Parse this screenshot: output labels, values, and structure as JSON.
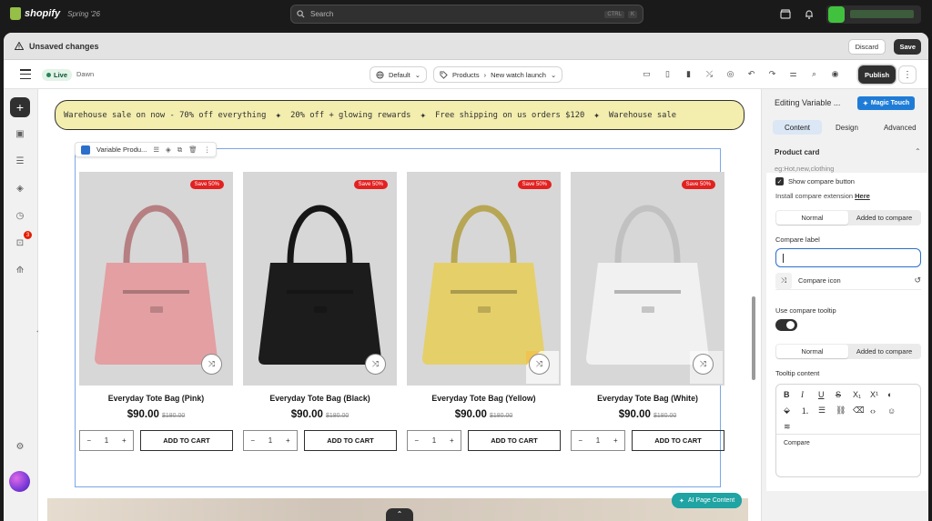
{
  "topbar": {
    "brand": "shopify",
    "season": "Spring '26",
    "search_placeholder": "Search",
    "shortcut_keys": [
      "CTRL",
      "K"
    ]
  },
  "unsaved": {
    "message": "Unsaved changes",
    "discard_label": "Discard",
    "save_label": "Save"
  },
  "toolbar": {
    "live_label": "Live",
    "theme_name": "Dawn",
    "template_select": "Default",
    "page_breadcrumb_1": "Products",
    "page_breadcrumb_2": "New watch launch",
    "publish_label": "Publish"
  },
  "rail": {
    "badge_count": "3"
  },
  "marquee": {
    "items": [
      "Warehouse sale on now - 70% off everything",
      "20% off + glowing rewards",
      "Free shipping on us orders $120",
      "Warehouse sale"
    ]
  },
  "section": {
    "tag_label": "Variable Produ..."
  },
  "products": [
    {
      "title": "Everyday Tote Bag (Pink)",
      "price": "$90.00",
      "compare_price": "$180.00",
      "badge": "Save 50%",
      "color": "#e39fa2",
      "qty": "1",
      "cta": "ADD TO CART"
    },
    {
      "title": "Everyday Tote Bag (Black)",
      "price": "$90.00",
      "compare_price": "$180.00",
      "badge": "Save 50%",
      "color": "#1c1c1c",
      "qty": "1",
      "cta": "ADD TO CART"
    },
    {
      "title": "Everyday Tote Bag (Yellow)",
      "price": "$90.00",
      "compare_price": "$180.00",
      "badge": "Save 50%",
      "color": "#e5cf69",
      "qty": "1",
      "cta": "ADD TO CART"
    },
    {
      "title": "Everyday Tote Bag (White)",
      "price": "$90.00",
      "compare_price": "$180.00",
      "badge": "Save 50%",
      "color": "#f1f1f1",
      "qty": "1",
      "cta": "ADD TO CART"
    }
  ],
  "ai_page_label": "AI Page Content",
  "panel": {
    "title": "Editing Variable ...",
    "magic_label": "Magic Touch",
    "tabs": [
      "Content",
      "Design",
      "Advanced"
    ],
    "section_title": "Product card",
    "hint": "eg:Hot,new,clothing",
    "show_compare_label": "Show compare button",
    "install_text": "Install compare extension",
    "install_link": "Here",
    "seg_normal": "Normal",
    "seg_added": "Added to compare",
    "compare_label_title": "Compare label",
    "compare_label_value": "",
    "compare_icon_label": "Compare icon",
    "use_tooltip_label": "Use compare tooltip",
    "tooltip_content_label": "Tooltip content",
    "tooltip_text": "Compare"
  },
  "colors": {
    "accent": "#2c6ecb",
    "sale_badge": "#e22120",
    "magic": "#1f7cd6",
    "ai_button": "#1fa3a3"
  }
}
